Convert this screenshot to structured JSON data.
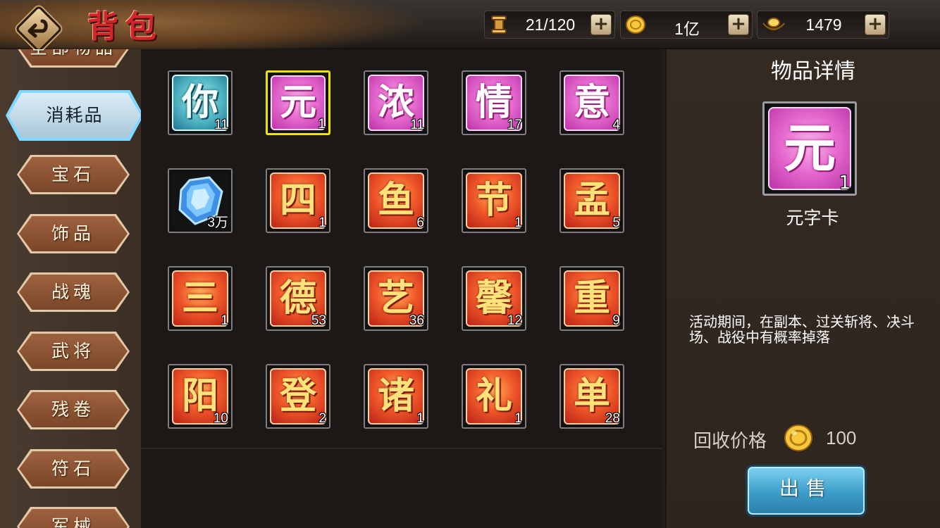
{
  "header": {
    "title": "背包",
    "resources": [
      {
        "name": "bag-capacity",
        "icon": "scroll-icon",
        "value": "21/120"
      },
      {
        "name": "gold",
        "icon": "gold-coin-icon",
        "value": "1亿"
      },
      {
        "name": "ingot",
        "icon": "gold-ingot-icon",
        "value": "1479"
      }
    ],
    "plus_label": "+"
  },
  "sidebar": {
    "partial_top_label": "全部物品",
    "tabs": [
      {
        "label": "消耗品",
        "active": true
      },
      {
        "label": "宝石"
      },
      {
        "label": "饰品"
      },
      {
        "label": "战魂"
      },
      {
        "label": "武将"
      },
      {
        "label": "残卷"
      },
      {
        "label": "符石"
      }
    ],
    "partial_bottom_label": "军械"
  },
  "items": [
    {
      "char": "你",
      "count": "11",
      "style": "blue"
    },
    {
      "char": "元",
      "count": "1",
      "style": "pink",
      "selected": true
    },
    {
      "char": "浓",
      "count": "11",
      "style": "pink"
    },
    {
      "char": "情",
      "count": "17",
      "style": "pink"
    },
    {
      "char": "意",
      "count": "4",
      "style": "pink"
    },
    {
      "char": "",
      "count": "3万",
      "style": "gem"
    },
    {
      "char": "四",
      "count": "1",
      "style": "red"
    },
    {
      "char": "鱼",
      "count": "6",
      "style": "red"
    },
    {
      "char": "节",
      "count": "1",
      "style": "red"
    },
    {
      "char": "孟",
      "count": "5",
      "style": "red"
    },
    {
      "char": "三",
      "count": "1",
      "style": "red"
    },
    {
      "char": "德",
      "count": "53",
      "style": "red"
    },
    {
      "char": "艺",
      "count": "36",
      "style": "red"
    },
    {
      "char": "馨",
      "count": "12",
      "style": "red"
    },
    {
      "char": "重",
      "count": "9",
      "style": "red"
    },
    {
      "char": "阳",
      "count": "10",
      "style": "red"
    },
    {
      "char": "登",
      "count": "2",
      "style": "red"
    },
    {
      "char": "诸",
      "count": "1",
      "style": "red"
    },
    {
      "char": "礼",
      "count": "1",
      "style": "red"
    },
    {
      "char": "单",
      "count": "28",
      "style": "red"
    }
  ],
  "detail": {
    "title": "物品详情",
    "icon_char": "元",
    "icon_count": "1",
    "item_name": "元字卡",
    "description": "活动期间，在副本、过关斩将、决斗场、战役中有概率掉落",
    "price_label": "回收价格",
    "price_value": "100",
    "sell_label": "出售"
  }
}
